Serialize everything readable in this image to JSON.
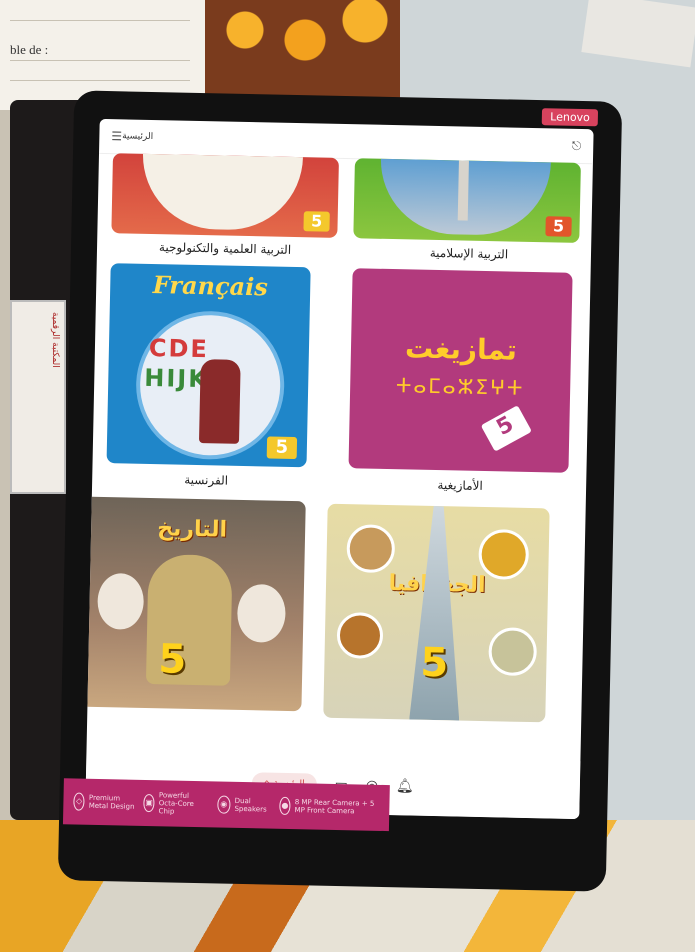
{
  "background": {
    "paper_text": "ble de :",
    "sticker_text": "المكتبة الرقمية"
  },
  "tablet": {
    "brand": "Lenovo",
    "topbar": {
      "title": "الرئيسية",
      "menu_icon": "hamburger-icon",
      "logout_icon": "logout-icon"
    },
    "books": [
      {
        "label": "التربية العلمية والتكنولوجية",
        "badge": "5"
      },
      {
        "label": "التربية الإسلامية",
        "badge": "5"
      },
      {
        "label": "الفرنسية",
        "cover_title": "Français",
        "badge": "5"
      },
      {
        "label": "الأمازيغية",
        "cover_title": "تمازيغت",
        "cover_subtitle": "ⵜⴰⵎⴰⵣⵉⵖⵜ",
        "badge": "5"
      },
      {
        "label": "",
        "cover_title": "التاريخ",
        "badge": "5"
      },
      {
        "label": "",
        "cover_title": "الجغرافيا",
        "badge": "5"
      }
    ],
    "navbar": {
      "home_label": "الرئيسية",
      "items": [
        "folder-icon",
        "profile-icon",
        "bell-icon"
      ]
    },
    "promo": [
      {
        "icon": "shield-icon",
        "text": "Premium Metal Design"
      },
      {
        "icon": "chip-icon",
        "text": "Powerful Octa-Core Chip"
      },
      {
        "icon": "speaker-icon",
        "text": "Dual Speakers"
      },
      {
        "icon": "camera-icon",
        "text": "8 MP Rear Camera + 5 MP Front Camera"
      }
    ]
  },
  "colors": {
    "lenovo_red": "#d8435e",
    "promo_magenta": "#b5286a",
    "amazigh_cover": "#b23a7d",
    "french_cover": "#1f86c9"
  }
}
